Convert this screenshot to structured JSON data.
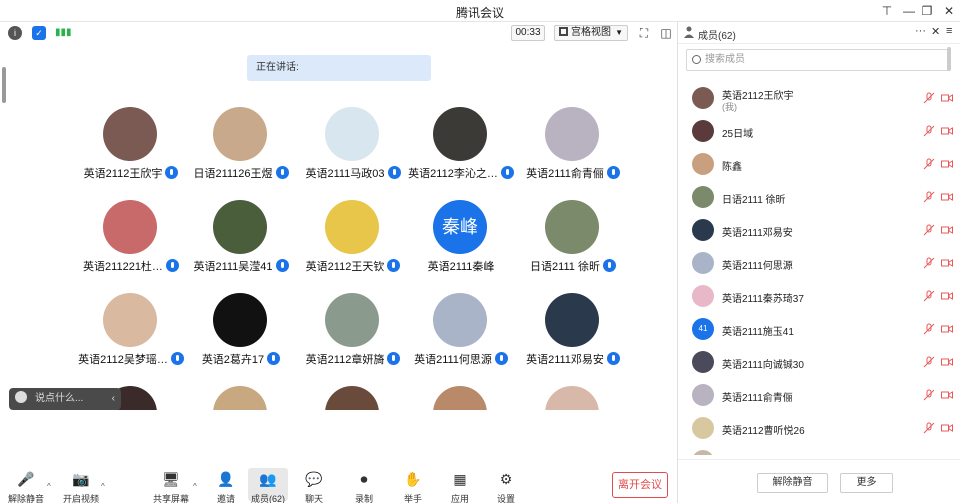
{
  "window": {
    "title": "腾讯会议",
    "pin": "⊤",
    "minimize": "—",
    "restore": "❐",
    "close": "✕"
  },
  "toolbar": {
    "timer": "00:33",
    "view_label": "宫格视图"
  },
  "speaking": "正在讲话:",
  "tiles": [
    {
      "name": "英语2112王欣宇",
      "color": "#7a5a52"
    },
    {
      "name": "日语211126王煜",
      "color": "#c9a98b"
    },
    {
      "name": "英语2111马政03",
      "color": "#d7e6ef"
    },
    {
      "name": "英语2112李沁之…",
      "color": "#3b3a36"
    },
    {
      "name": "英语2111俞青俪",
      "color": "#b9b2c0"
    },
    {
      "name": "英语211221杜…",
      "color": "#c86a6a"
    },
    {
      "name": "英语2111吴滢41",
      "color": "#4a5e3c"
    },
    {
      "name": "英语2112王天钦",
      "color": "#e8c64a"
    },
    {
      "name": "英语2111秦峰",
      "text": "秦峰",
      "color": "#1a73e8",
      "nomic": true
    },
    {
      "name": "日语2111 徐昕",
      "color": "#7a8a6a"
    },
    {
      "name": "英语2112吴梦瑶…",
      "color": "#d9b9a0"
    },
    {
      "name": "英语2葛卉17",
      "color": "#111111"
    },
    {
      "name": "英语2112章妍旖",
      "color": "#8a9a8c"
    },
    {
      "name": "英语2111何思源",
      "color": "#a9b4c9"
    },
    {
      "name": "英语2111邓易安",
      "color": "#2a3a4c"
    },
    {
      "name": "",
      "color": "#3a2a2a"
    },
    {
      "name": "",
      "color": "#c8a880"
    },
    {
      "name": "",
      "color": "#6a4a3a"
    },
    {
      "name": "",
      "color": "#b88a6a"
    },
    {
      "name": "",
      "color": "#d8b8a8"
    }
  ],
  "chat_placeholder": "说点什么...",
  "bottom": [
    {
      "label": "解除静音",
      "icon": "🎤"
    },
    {
      "label": "开启视频",
      "icon": "📷"
    },
    {
      "label": "共享屏幕",
      "icon": "🖥"
    },
    {
      "label": "邀请",
      "icon": "👤"
    },
    {
      "label": "成员(62)",
      "icon": "👥"
    },
    {
      "label": "聊天",
      "icon": "💬"
    },
    {
      "label": "录制",
      "icon": "⏺"
    },
    {
      "label": "举手",
      "icon": "✋"
    },
    {
      "label": "应用",
      "icon": "▦"
    },
    {
      "label": "设置",
      "icon": "⚙"
    }
  ],
  "leave": "离开会议",
  "panel": {
    "title": "成员(62)",
    "search_placeholder": "搜索成员",
    "members": [
      {
        "name": "英语2112王欣宇",
        "sub": "(我)",
        "color": "#7a5a52"
      },
      {
        "name": "25日域",
        "color": "#5a3a3a"
      },
      {
        "name": "陈鑫",
        "color": "#c8a080"
      },
      {
        "name": "日语2111 徐昕",
        "color": "#7a8a6a"
      },
      {
        "name": "英语2111邓易安",
        "color": "#2a3a4c"
      },
      {
        "name": "英语2111何思源",
        "color": "#a9b4c9"
      },
      {
        "name": "英语2111秦苏琦37",
        "color": "#e8b8c8"
      },
      {
        "name": "英语2111施玉41",
        "text": "41",
        "color": "#1a73e8"
      },
      {
        "name": "英语2111向诚铖30",
        "color": "#4a4a5a"
      },
      {
        "name": "英语2111俞青俪",
        "color": "#b9b2c0"
      },
      {
        "name": "英语2112曹听悦26",
        "color": "#d8c8a0"
      },
      {
        "name": "",
        "color": "#c8b8a8"
      }
    ],
    "unmute_all": "解除静音",
    "more": "更多"
  }
}
